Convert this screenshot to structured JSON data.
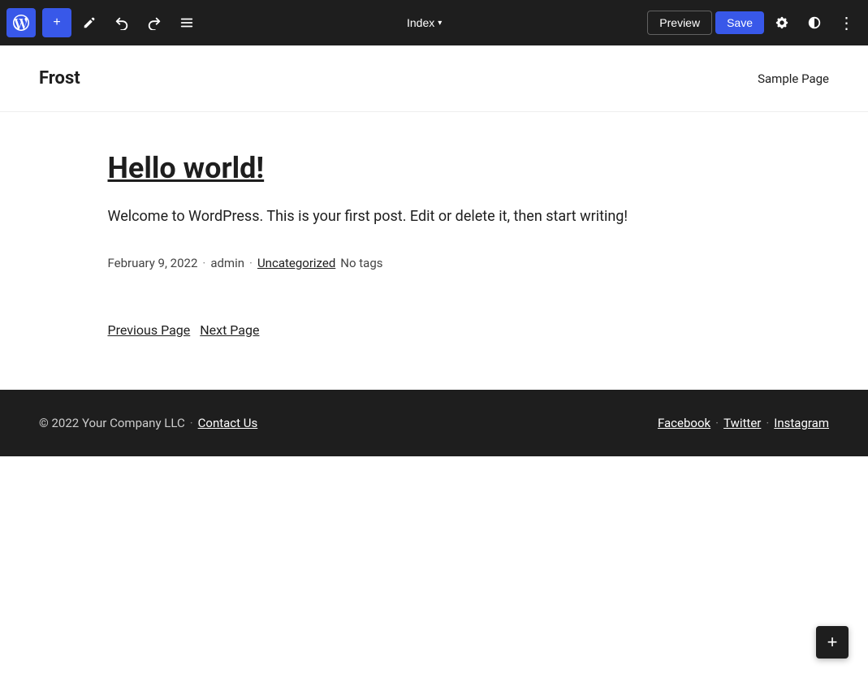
{
  "toolbar": {
    "add_label": "+",
    "edit_label": "✏",
    "undo_label": "←",
    "redo_label": "→",
    "list_label": "≡",
    "index_label": "Index",
    "preview_label": "Preview",
    "save_label": "Save",
    "settings_label": "⚙",
    "contrast_label": "◑",
    "more_label": "⋮"
  },
  "site": {
    "title": "Frost",
    "nav": {
      "sample_page": "Sample Page"
    }
  },
  "post": {
    "title": "Hello world!",
    "excerpt": "Welcome to WordPress. This is your first post. Edit or delete it, then start writing!",
    "date": "February 9, 2022",
    "author": "admin",
    "category": "Uncategorized",
    "tags": "No tags"
  },
  "pagination": {
    "previous": "Previous Page",
    "next": "Next Page"
  },
  "footer": {
    "copyright": "© 2022 Your Company LLC",
    "separator": "·",
    "contact_label": "Contact Us",
    "social": {
      "facebook": "Facebook",
      "twitter": "Twitter",
      "instagram": "Instagram"
    }
  },
  "floating": {
    "add_label": "+"
  }
}
